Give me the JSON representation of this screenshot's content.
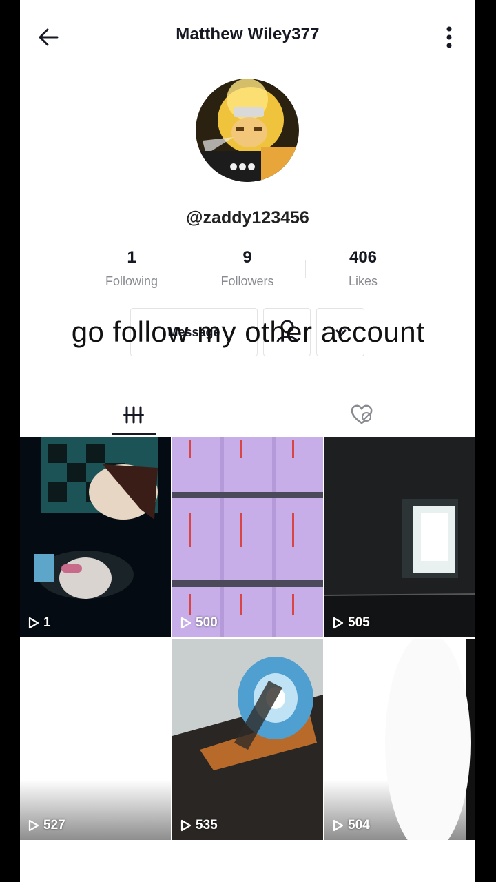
{
  "header": {
    "title": "Matthew Wiley377",
    "back_icon": "arrow-left-icon",
    "more_icon": "vertical-dots-icon"
  },
  "profile": {
    "username": "@zaddy123456",
    "stats": [
      {
        "value": "1",
        "label": "Following"
      },
      {
        "value": "9",
        "label": "Followers"
      },
      {
        "value": "406",
        "label": "Likes"
      }
    ],
    "message_label": "Message"
  },
  "overlay_caption": "go follow my other account",
  "tabs": [
    {
      "icon": "grid-icon",
      "active": true
    },
    {
      "icon": "liked-heart-icon",
      "active": false
    }
  ],
  "videos": [
    {
      "views": "1"
    },
    {
      "views": "500"
    },
    {
      "views": "505"
    },
    {
      "views": "527"
    },
    {
      "views": "535"
    },
    {
      "views": "504"
    }
  ]
}
